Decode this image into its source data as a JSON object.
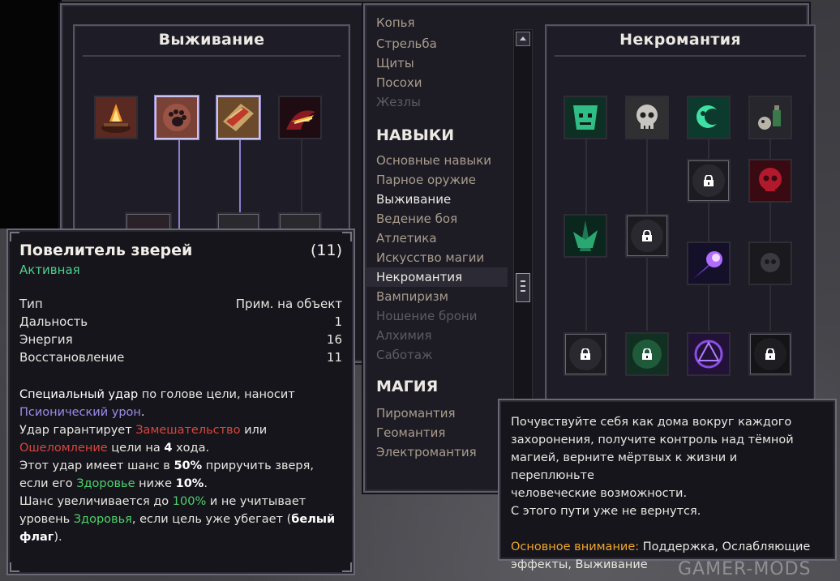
{
  "survival_panel": {
    "title": "Выживание"
  },
  "necro_panel": {
    "title": "Некромантия"
  },
  "menu": {
    "weapons": [
      {
        "label": "Копья",
        "state": "normal"
      },
      {
        "label": "Стрельба",
        "state": "normal"
      },
      {
        "label": "Щиты",
        "state": "normal"
      },
      {
        "label": "Посохи",
        "state": "normal"
      },
      {
        "label": "Жезлы",
        "state": "dim"
      }
    ],
    "skills_header": "НАВЫКИ",
    "skills": [
      {
        "label": "Основные навыки",
        "state": "normal"
      },
      {
        "label": "Парное оружие",
        "state": "normal"
      },
      {
        "label": "Выживание",
        "state": "active"
      },
      {
        "label": "Ведение боя",
        "state": "normal"
      },
      {
        "label": "Атлетика",
        "state": "normal"
      },
      {
        "label": "Искусство магии",
        "state": "normal"
      },
      {
        "label": "Некромантия",
        "state": "selected"
      },
      {
        "label": "Вампиризм",
        "state": "normal"
      },
      {
        "label": "Ношение брони",
        "state": "dim"
      },
      {
        "label": "Алхимия",
        "state": "dim"
      },
      {
        "label": "Саботаж",
        "state": "dim"
      }
    ],
    "magic_header": "МАГИЯ",
    "magic": [
      {
        "label": "Пиромантия",
        "state": "normal"
      },
      {
        "label": "Геомантия",
        "state": "normal"
      },
      {
        "label": "Электромантия",
        "state": "normal"
      }
    ]
  },
  "skill_tooltip": {
    "name": "Повелитель зверей",
    "cost": "(11)",
    "type_label": "Активная",
    "stats": [
      {
        "label": "Тип",
        "value": "Прим. на объект"
      },
      {
        "label": "Дальность",
        "value": "1"
      },
      {
        "label": "Энергия",
        "value": "16"
      },
      {
        "label": "Восстановление",
        "value": "11"
      }
    ],
    "desc": {
      "l1a": "Специальный удар",
      "l1b": " по голове цели, наносит",
      "l2": "Псионический урон",
      "l2b": ".",
      "l3a": "Удар гарантирует ",
      "l3b": "Замешательство",
      "l3c": " или",
      "l4a": "Ошеломление",
      "l4b": " цели на ",
      "l4c": "4",
      "l4d": " хода.",
      "l5a": "Этот удар имеет шанс в ",
      "l5b": "50%",
      "l5c": " приручить зверя,",
      "l6a": "если его ",
      "l6b": "Здоровье",
      "l6c": " ниже ",
      "l6d": "10%",
      "l6e": ".",
      "l7a": "Шанс увеличивается до ",
      "l7b": "100%",
      "l7c": " и не учитывает",
      "l8a": "уровень ",
      "l8b": "Здоровья",
      "l8c": ", если цель уже убегает (",
      "l8d": "белый",
      "l9a": "флаг",
      "l9b": ")."
    }
  },
  "school_tooltip": {
    "lines": [
      "Почувствуйте себя как дома вокруг каждого",
      "захоронения, получите контроль над тёмной",
      "магией, верните мёртвых к жизни и переплюньте",
      "человеческие возможности.",
      "С этого пути уже не вернутся."
    ],
    "focus_label": "Основное внимание:",
    "focus_value1": " Поддержка, Ослабляющие",
    "focus_value2": "эффекты, Выживание"
  },
  "watermark": "GAMER-MODS"
}
